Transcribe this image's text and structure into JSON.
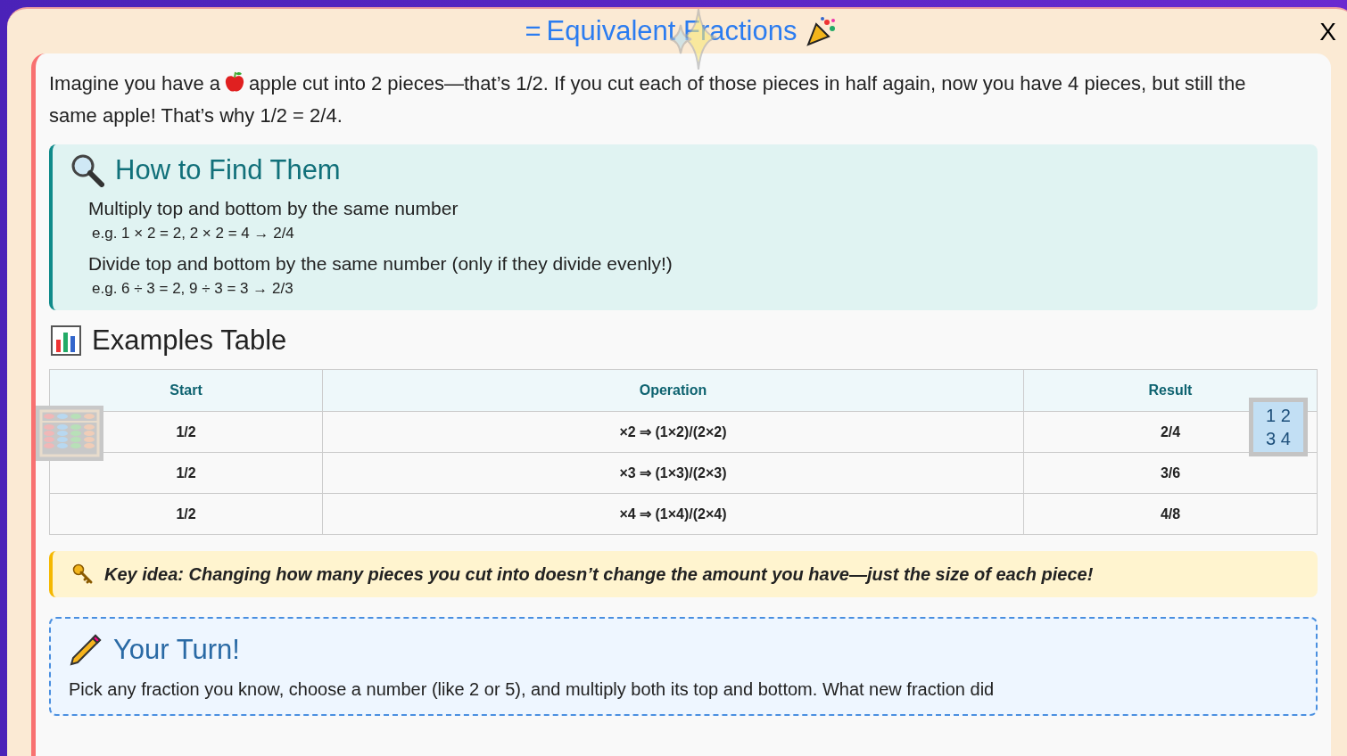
{
  "title": "Equivalent Fractions",
  "close": "X",
  "title_icon": "=",
  "intro_parts": [
    "Imagine you have a",
    "apple cut into 2 pieces—that’s 1/2. If you cut each of those pieces in half again, now you have 4 pieces, but still the same apple! That’s why 1/2 = 2/4."
  ],
  "how": {
    "heading": "How to Find Them",
    "rules": [
      {
        "rule": "Multiply top and bottom by the same number",
        "example": "e.g. 1 × 2 = 2, 2 × 2 = 4 → 2/4"
      },
      {
        "rule": "Divide top and bottom by the same number (only if they divide evenly!)",
        "example": "e.g. 6 ÷ 3 = 2, 9 ÷ 3 = 3 → 2/3"
      }
    ]
  },
  "examples": {
    "heading": "Examples Table",
    "columns": [
      "Start",
      "Operation",
      "Result"
    ],
    "rows": [
      [
        "1/2",
        "×2 ⇒ (1×2)/(2×2)",
        "2/4"
      ],
      [
        "1/2",
        "×3 ⇒ (1×3)/(2×3)",
        "3/6"
      ],
      [
        "1/2",
        "×4 ⇒ (1×4)/(2×4)",
        "4/8"
      ]
    ]
  },
  "number_tile": [
    "1 2",
    "3 4"
  ],
  "key_idea": "Key idea: Changing how many pieces you cut into doesn’t change the amount you have—just the size of each piece!",
  "your_turn": {
    "heading": "Your Turn!",
    "text": "Pick any fraction you know, choose a number (like 2 or 5), and multiply both its top and bottom. What new fraction did"
  }
}
